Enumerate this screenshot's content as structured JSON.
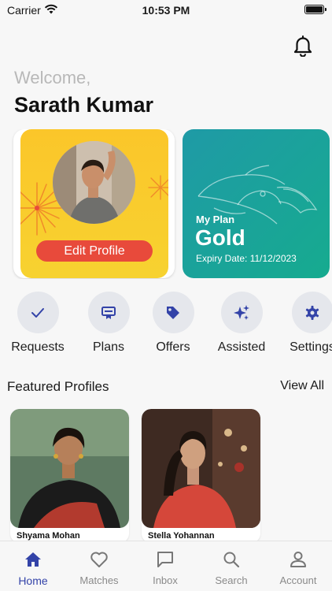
{
  "status_bar": {
    "carrier": "Carrier",
    "time": "10:53 PM"
  },
  "header": {
    "welcome": "Welcome,",
    "user_name": "Sarath Kumar"
  },
  "profile_card": {
    "edit_label": "Edit Profile"
  },
  "plan_card": {
    "label": "My Plan",
    "name": "Gold",
    "expiry": "Expiry Date: 11/12/2023"
  },
  "quick_actions": [
    {
      "label": "Requests",
      "icon": "check-icon"
    },
    {
      "label": "Plans",
      "icon": "plans-icon"
    },
    {
      "label": "Offers",
      "icon": "tag-icon"
    },
    {
      "label": "Assisted",
      "icon": "sparkle-icon"
    },
    {
      "label": "Settings",
      "icon": "gear-icon"
    }
  ],
  "featured": {
    "title": "Featured Profiles",
    "view_all": "View All",
    "profiles": [
      {
        "name": "Shyama Mohan"
      },
      {
        "name": "Stella Yohannan"
      }
    ]
  },
  "tab_bar": {
    "active": "Home",
    "items": [
      {
        "label": "Home",
        "icon": "home-icon"
      },
      {
        "label": "Matches",
        "icon": "heart-icon"
      },
      {
        "label": "Inbox",
        "icon": "chat-icon"
      },
      {
        "label": "Search",
        "icon": "search-icon"
      },
      {
        "label": "Account",
        "icon": "account-icon"
      }
    ]
  },
  "colors": {
    "accent": "#3343a8",
    "edit_button": "#e84a3b",
    "plan_card": "#16ab8f",
    "profile_card": "#fbc62a"
  }
}
